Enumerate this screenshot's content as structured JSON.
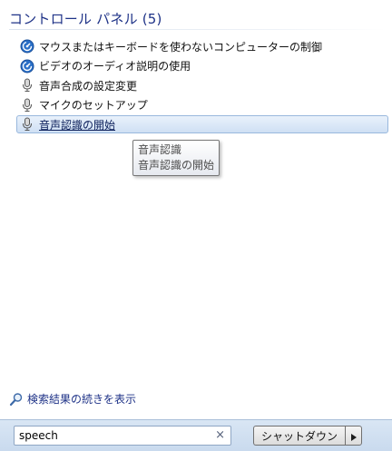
{
  "group": {
    "header": "コントロール パネル (5)"
  },
  "results": [
    {
      "label": "マウスまたはキーボードを使わないコンピューターの制御",
      "icon": "ease-of-access-icon",
      "selected": false
    },
    {
      "label": "ビデオのオーディオ説明の使用",
      "icon": "ease-of-access-icon",
      "selected": false
    },
    {
      "label": "音声合成の設定変更",
      "icon": "microphone-icon",
      "selected": false
    },
    {
      "label": "マイクのセットアップ",
      "icon": "microphone-icon",
      "selected": false
    },
    {
      "label": "音声認識の開始",
      "icon": "microphone-icon",
      "selected": true
    }
  ],
  "tooltip": {
    "line1": "音声認識",
    "line2": "音声認識の開始"
  },
  "more_results": {
    "label": "検索結果の続きを表示",
    "icon": "magnifier-icon"
  },
  "search": {
    "value": "speech",
    "clear_glyph": "×",
    "clear_icon": "clear-icon"
  },
  "shutdown": {
    "label": "シャットダウン",
    "arrow_icon": "triangle-right-icon"
  },
  "colors": {
    "header_text": "#1e3287",
    "selection_border": "#99b8dd",
    "selection_fill": "#cfe0f4",
    "bottom_bar": "#d9e6f4"
  }
}
